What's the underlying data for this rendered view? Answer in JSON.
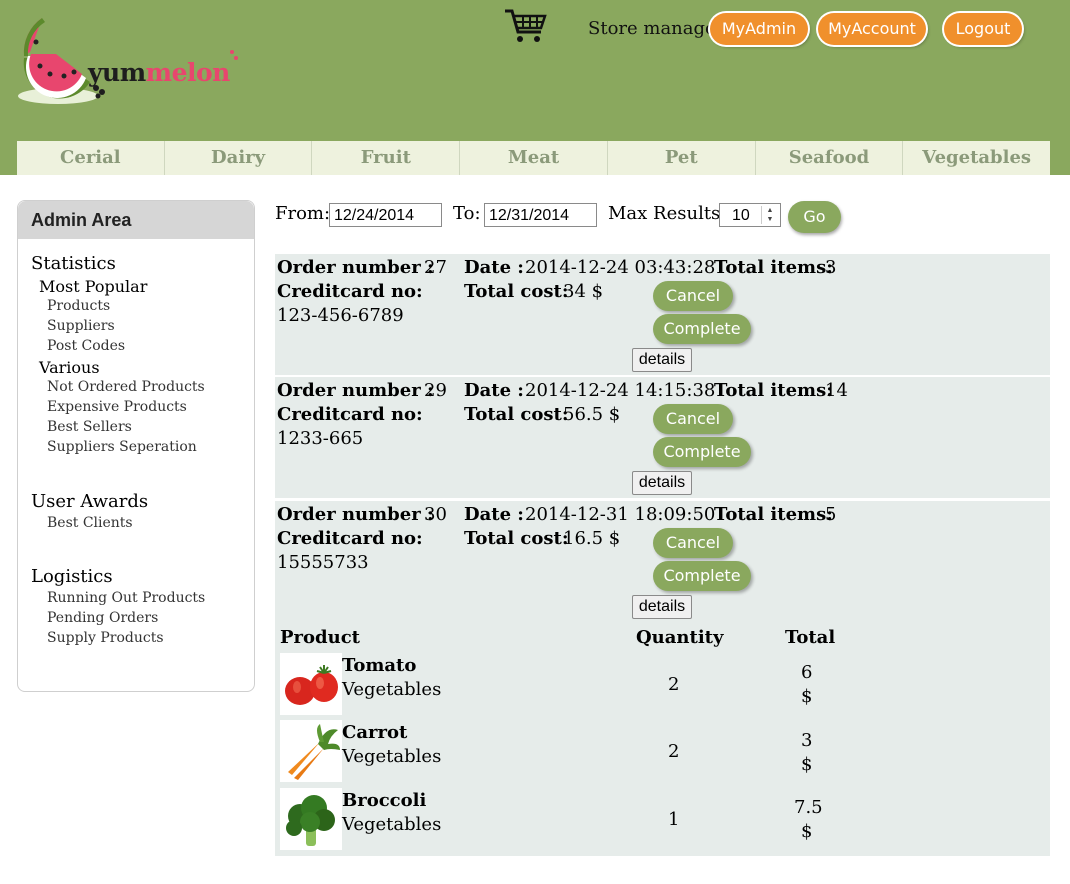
{
  "header": {
    "logo": {
      "text_dark": "yum",
      "text_pink": "melon"
    },
    "store_label": "Store manager",
    "buttons": {
      "myadmin": "MyAdmin",
      "myaccount": "MyAccount",
      "logout": "Logout"
    }
  },
  "categories": [
    "Cerial",
    "Dairy",
    "Fruit",
    "Meat",
    "Pet",
    "Seafood",
    "Vegetables"
  ],
  "sidebar": {
    "title": "Admin Area",
    "statistics": "Statistics",
    "most_popular": "Most Popular",
    "mp_links": [
      "Products",
      "Suppliers",
      "Post Codes"
    ],
    "various": "Various",
    "var_links": [
      "Not Ordered Products",
      "Expensive Products",
      "Best Sellers",
      "Suppliers Seperation"
    ],
    "user_awards": "User Awards",
    "ua_links": [
      "Best Clients"
    ],
    "logistics": "Logistics",
    "log_links": [
      "Running Out Products",
      "Pending Orders",
      "Supply Products"
    ]
  },
  "filter": {
    "from_label": "From:",
    "from_value": "12/24/2014",
    "to_label": "To:",
    "to_value": "12/31/2014",
    "max_label": "Max Results:",
    "max_value": "10",
    "go_label": "Go"
  },
  "labels": {
    "order_number": "Order number :",
    "date": "Date :",
    "total_items": "Total items:",
    "creditcard": "Creditcard no:",
    "total_cost": "Total cost:",
    "cancel": "Cancel",
    "complete": "Complete",
    "details": "details",
    "col_product": "Product",
    "col_quantity": "Quantity",
    "col_total": "Total"
  },
  "orders": [
    {
      "number": "27",
      "date": "2014-12-24 03:43:28",
      "items": "3",
      "cc": "123-456-6789",
      "cost": "34 $"
    },
    {
      "number": "29",
      "date": "2014-12-24 14:15:38",
      "items": "14",
      "cc": "1233-665",
      "cost": "56.5 $"
    },
    {
      "number": "30",
      "date": "2014-12-31 18:09:50",
      "items": "5",
      "cc": "15555733",
      "cost": "16.5 $"
    }
  ],
  "details_products": [
    {
      "name": "Tomato",
      "category": "Vegetables",
      "quantity": "2",
      "total": "6",
      "currency": "$",
      "icon": "tomato-image"
    },
    {
      "name": "Carrot",
      "category": "Vegetables",
      "quantity": "2",
      "total": "3",
      "currency": "$",
      "icon": "carrot-image"
    },
    {
      "name": "Broccoli",
      "category": "Vegetables",
      "quantity": "1",
      "total": "7.5",
      "currency": "$",
      "icon": "broccoli-image"
    }
  ]
}
